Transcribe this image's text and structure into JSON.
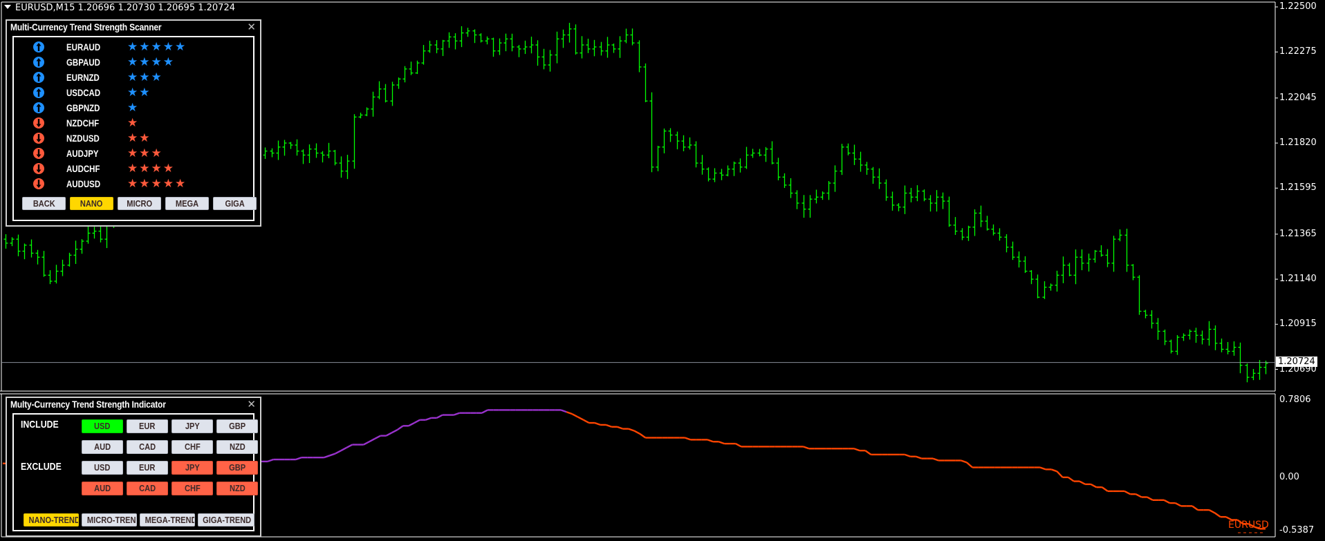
{
  "main_chart": {
    "title": "EURUSD,M15  1.20696 1.20730 1.20695 1.20724",
    "price_axis": [
      "1.22500",
      "1.22275",
      "1.22045",
      "1.21820",
      "1.21595",
      "1.21365",
      "1.21140",
      "1.20915",
      "1.20690"
    ],
    "current_price": "1.20724",
    "bar_color": "#00ff00",
    "price_line_color": "#8a8f9a",
    "price_range": [
      1.2058,
      1.225
    ],
    "bars_closes": [
      1.2132,
      1.2134,
      1.2128,
      1.2131,
      1.2127,
      1.2125,
      1.2116,
      1.2113,
      1.2118,
      1.2121,
      1.2126,
      1.2129,
      1.2133,
      1.2137,
      1.2138,
      1.2134,
      1.2141,
      1.2149,
      1.2152,
      1.2151,
      1.215,
      1.2155,
      1.2158,
      1.2162,
      1.216,
      1.2158,
      1.216,
      1.2158,
      1.2157,
      1.2158,
      1.216,
      1.2163,
      1.2162,
      1.2164,
      1.2166,
      1.2167,
      1.217,
      1.2172,
      1.2171,
      1.2174,
      1.2176,
      1.2178,
      1.2177,
      1.218,
      1.2182,
      1.2181,
      1.2178,
      1.2176,
      1.2179,
      1.2177,
      1.2176,
      1.2178,
      1.2172,
      1.2168,
      1.2173,
      1.2195,
      1.2196,
      1.2199,
      1.2205,
      1.2209,
      1.2203,
      1.2211,
      1.2214,
      1.2219,
      1.2217,
      1.2222,
      1.2228,
      1.2231,
      1.2229,
      1.2233,
      1.2235,
      1.2233,
      1.2237,
      1.2238,
      1.2236,
      1.2233,
      1.2234,
      1.2228,
      1.2232,
      1.2234,
      1.223,
      1.2229,
      1.223,
      1.2231,
      1.2225,
      1.2221,
      1.2226,
      1.2234,
      1.2236,
      1.2239,
      1.2227,
      1.2231,
      1.2229,
      1.223,
      1.2228,
      1.2231,
      1.2229,
      1.2233,
      1.2236,
      1.2232,
      1.222,
      1.2203,
      1.217,
      1.218,
      1.2188,
      1.2186,
      1.2183,
      1.218,
      1.2181,
      1.2172,
      1.2169,
      1.2164,
      1.2167,
      1.2166,
      1.2169,
      1.2172,
      1.217,
      1.2176,
      1.2177,
      1.2176,
      1.2179,
      1.2172,
      1.2165,
      1.2161,
      1.2157,
      1.2152,
      1.2149,
      1.2154,
      1.2155,
      1.2157,
      1.2162,
      1.2168,
      1.218,
      1.2177,
      1.2174,
      1.2171,
      1.2169,
      1.2165,
      1.2162,
      1.2155,
      1.2151,
      1.215,
      1.2157,
      1.2155,
      1.2158,
      1.2154,
      1.2152,
      1.2155,
      1.2153,
      1.2141,
      1.2138,
      1.2135,
      1.214,
      1.2147,
      1.2143,
      1.2139,
      1.2137,
      1.2135,
      1.213,
      1.2125,
      1.2123,
      1.2118,
      1.2114,
      1.2105,
      1.211,
      1.2111,
      1.2116,
      1.2121,
      1.2116,
      1.2125,
      1.2122,
      1.2124,
      1.2128,
      1.2126,
      1.2122,
      1.2134,
      1.2136,
      1.2121,
      1.2115,
      1.2098,
      1.2096,
      1.2092,
      1.2088,
      1.2083,
      1.2078,
      1.2085,
      1.2086,
      1.2088,
      1.2086,
      1.2084,
      1.2089,
      1.2082,
      1.2079,
      1.2078,
      1.208,
      1.2071,
      1.2065,
      1.2067,
      1.207,
      1.2072
    ]
  },
  "scanner": {
    "title": "Multi-Currency Trend Strength Scanner",
    "close_icon": "close-icon",
    "rows": [
      {
        "pair": "EURAUD",
        "direction": "up",
        "stars": 5
      },
      {
        "pair": "GBPAUD",
        "direction": "up",
        "stars": 4
      },
      {
        "pair": "EURNZD",
        "direction": "up",
        "stars": 3
      },
      {
        "pair": "USDCAD",
        "direction": "up",
        "stars": 2
      },
      {
        "pair": "GBPNZD",
        "direction": "up",
        "stars": 1
      },
      {
        "pair": "NZDCHF",
        "direction": "down",
        "stars": 1
      },
      {
        "pair": "NZDUSD",
        "direction": "down",
        "stars": 2
      },
      {
        "pair": "AUDJPY",
        "direction": "down",
        "stars": 3
      },
      {
        "pair": "AUDCHF",
        "direction": "down",
        "stars": 4
      },
      {
        "pair": "AUDUSD",
        "direction": "down",
        "stars": 5
      }
    ],
    "up_color": "#1e90ff",
    "down_color": "#ff5a3c",
    "buttons": [
      {
        "label": "BACK",
        "active": false
      },
      {
        "label": "NANO",
        "active": true
      },
      {
        "label": "MICRO",
        "active": false
      },
      {
        "label": "MEGA",
        "active": false
      },
      {
        "label": "GIGA",
        "active": false
      }
    ]
  },
  "indicator_panel": {
    "title": "Multy-Currency Trend Strength Indicator",
    "close_icon": "close-icon",
    "include_label": "INCLUDE",
    "exclude_label": "EXCLUDE",
    "include": [
      {
        "label": "USD",
        "state": "green"
      },
      {
        "label": "EUR",
        "state": "off"
      },
      {
        "label": "JPY",
        "state": "off"
      },
      {
        "label": "GBP",
        "state": "off"
      },
      {
        "label": "AUD",
        "state": "off"
      },
      {
        "label": "CAD",
        "state": "off"
      },
      {
        "label": "CHF",
        "state": "off"
      },
      {
        "label": "NZD",
        "state": "off"
      }
    ],
    "exclude": [
      {
        "label": "USD",
        "state": "off"
      },
      {
        "label": "EUR",
        "state": "off"
      },
      {
        "label": "JPY",
        "state": "red"
      },
      {
        "label": "GBP",
        "state": "red"
      },
      {
        "label": "AUD",
        "state": "red"
      },
      {
        "label": "CAD",
        "state": "red"
      },
      {
        "label": "CHF",
        "state": "red"
      },
      {
        "label": "NZD",
        "state": "red"
      }
    ],
    "trend_buttons": [
      {
        "label": "NANO-TREND",
        "active": true
      },
      {
        "label": "MICRO-TREND",
        "active": false
      },
      {
        "label": "MEGA-TREND",
        "active": false
      },
      {
        "label": "GIGA-TREND",
        "active": false
      }
    ]
  },
  "indicator_chart": {
    "axis": [
      "0.7806",
      "0.00",
      "-0.5387"
    ],
    "range": [
      -0.5387,
      0.7806
    ],
    "symbol_label": "EURUSD",
    "up_color": "#9932cc",
    "down_color": "#ff4500",
    "values": [
      0.14,
      0.14,
      0.14,
      0.14,
      0.14,
      0.14,
      0.14,
      0.14,
      0.14,
      0.14,
      0.14,
      0.14,
      0.14,
      0.14,
      0.14,
      0.14,
      0.14,
      0.14,
      0.14,
      0.14,
      0.14,
      0.14,
      0.14,
      0.14,
      0.14,
      0.14,
      0.14,
      0.14,
      0.14,
      0.14,
      0.14,
      0.14,
      0.14,
      0.14,
      0.14,
      0.14,
      0.14,
      0.14,
      0.14,
      0.14,
      0.14,
      0.14,
      0.14,
      0.14,
      0.14,
      0.16,
      0.16,
      0.16,
      0.18,
      0.18,
      0.18,
      0.18,
      0.18,
      0.2,
      0.2,
      0.2,
      0.2,
      0.2,
      0.22,
      0.24,
      0.27,
      0.3,
      0.33,
      0.33,
      0.33,
      0.36,
      0.39,
      0.42,
      0.42,
      0.45,
      0.48,
      0.52,
      0.52,
      0.55,
      0.58,
      0.58,
      0.6,
      0.6,
      0.63,
      0.63,
      0.63,
      0.65,
      0.65,
      0.65,
      0.65,
      0.65,
      0.68,
      0.68,
      0.68,
      0.68,
      0.68,
      0.68,
      0.68,
      0.68,
      0.68,
      0.68,
      0.68,
      0.68,
      0.68,
      0.68,
      0.66,
      0.64,
      0.61,
      0.58,
      0.55,
      0.55,
      0.53,
      0.53,
      0.51,
      0.51,
      0.49,
      0.49,
      0.47,
      0.44,
      0.4,
      0.4,
      0.4,
      0.4,
      0.4,
      0.4,
      0.4,
      0.4,
      0.38,
      0.38,
      0.38,
      0.38,
      0.36,
      0.36,
      0.34,
      0.34,
      0.34,
      0.31,
      0.31,
      0.31,
      0.31,
      0.31,
      0.31,
      0.31,
      0.31,
      0.31,
      0.31,
      0.31,
      0.31,
      0.29,
      0.29,
      0.29,
      0.29,
      0.29,
      0.29,
      0.29,
      0.29,
      0.29,
      0.27,
      0.27,
      0.23,
      0.23,
      0.23,
      0.23,
      0.23,
      0.23,
      0.23,
      0.21,
      0.21,
      0.19,
      0.19,
      0.19,
      0.17,
      0.17,
      0.17,
      0.17,
      0.17,
      0.15,
      0.1,
      0.1,
      0.1,
      0.1,
      0.1,
      0.1,
      0.1,
      0.1,
      0.1,
      0.1,
      0.1,
      0.1,
      0.1,
      0.08,
      0.08,
      0.06,
      0.0,
      0.0,
      -0.04,
      -0.04,
      -0.07,
      -0.07,
      -0.1,
      -0.1,
      -0.14,
      -0.14,
      -0.14,
      -0.14,
      -0.17,
      -0.17,
      -0.2,
      -0.2,
      -0.23,
      -0.23,
      -0.23,
      -0.26,
      -0.26,
      -0.29,
      -0.29,
      -0.29,
      -0.33,
      -0.33,
      -0.33,
      -0.36,
      -0.4,
      -0.4,
      -0.43,
      -0.43,
      -0.47,
      -0.47,
      -0.5,
      -0.52,
      -0.52
    ]
  }
}
